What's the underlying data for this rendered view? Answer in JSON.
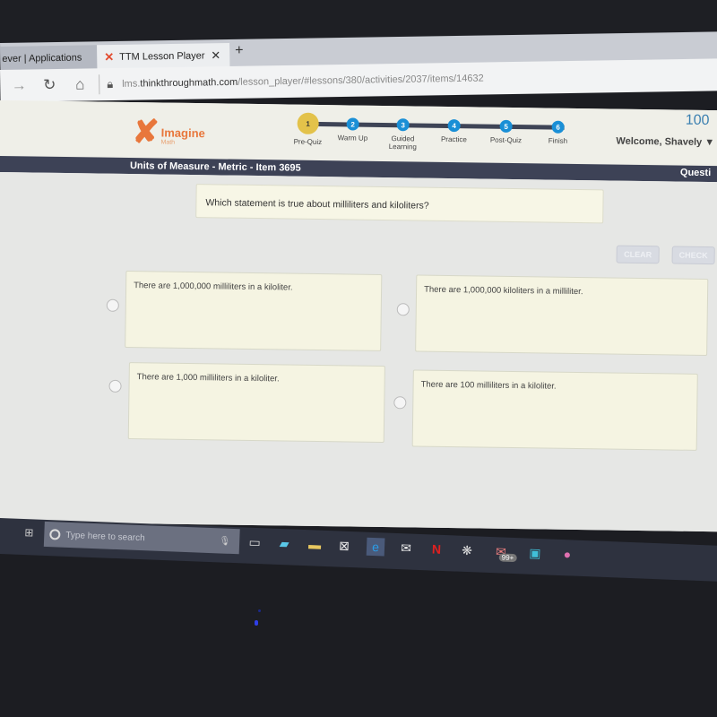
{
  "browser": {
    "tabs": [
      {
        "label": "ever | Applications",
        "active": false
      },
      {
        "label": "TTM Lesson Player",
        "active": true,
        "icon": "imagine-math-icon"
      }
    ],
    "close_tab_icon": "close-icon",
    "new_tab_icon": "plus-icon",
    "nav": {
      "forward_icon": "arrow-right-icon",
      "refresh_icon": "refresh-icon",
      "home_icon": "home-icon",
      "lock_icon": "lock-icon"
    },
    "url_host_prefix": "lms.",
    "url_domain": "thinkthroughmath.com",
    "url_path": "/lesson_player/#lessons/380/activities/2037/items/14632"
  },
  "header": {
    "logo": {
      "title": "Imagine",
      "subtitle": "Math"
    },
    "steps": [
      {
        "number": "1",
        "label": "Pre-Quiz",
        "state": "active"
      },
      {
        "number": "2",
        "label": "Warm Up",
        "state": "todo"
      },
      {
        "number": "3",
        "label": "Guided Learning",
        "state": "todo"
      },
      {
        "number": "4",
        "label": "Practice",
        "state": "todo"
      },
      {
        "number": "5",
        "label": "Post-Quiz",
        "state": "todo"
      },
      {
        "number": "6",
        "label": "Finish",
        "state": "todo"
      }
    ],
    "score": "100",
    "welcome": "Welcome, Shavely",
    "dropdown_icon": "caret-down-icon"
  },
  "titlebar": {
    "unit_title": "Units of Measure - Metric - Item 3695",
    "question_label": "Questi"
  },
  "question": {
    "prompt": "Which statement is true about milliliters and kiloliters?",
    "clear_label": "CLEAR",
    "check_label": "CHECK",
    "options": [
      {
        "text": "There are 1,000,000 milliliters in a kiloliter.",
        "selected": false
      },
      {
        "text": "There are 1,000,000 kiloliters in a milliliter.",
        "selected": false
      },
      {
        "text": "There are 1,000 milliliters in a kiloliter.",
        "selected": false
      },
      {
        "text": "There are 100 milliliters in a kiloliter.",
        "selected": false
      }
    ]
  },
  "taskbar": {
    "search_placeholder": "Type here to search",
    "mail_badge": "99+",
    "icons": [
      "windows-start-icon",
      "cortana-icon",
      "microphone-icon",
      "task-view-icon",
      "teams-icon",
      "file-explorer-icon",
      "store-icon",
      "edge-icon",
      "mail-icon",
      "netflix-icon",
      "app-icon",
      "email-icon",
      "media-icon",
      "pink-app-icon"
    ]
  }
}
